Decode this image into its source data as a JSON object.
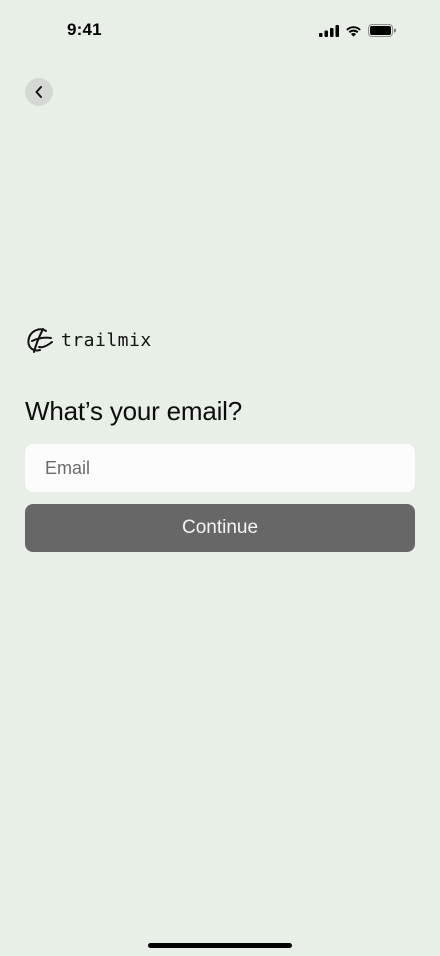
{
  "status_bar": {
    "time": "9:41",
    "icons": [
      "signal-icon",
      "wifi-icon",
      "battery-icon"
    ]
  },
  "navigation": {
    "back_icon": "chevron-left-icon"
  },
  "brand": {
    "logo_text": "trailmix",
    "logo_mark": "trailmix-mark-icon"
  },
  "form": {
    "heading": "What’s your email?",
    "email_placeholder": "Email",
    "email_value": "",
    "continue_label": "Continue"
  },
  "colors": {
    "background": "#e8efe7",
    "button": "#676767",
    "input": "#fbfcfb"
  }
}
